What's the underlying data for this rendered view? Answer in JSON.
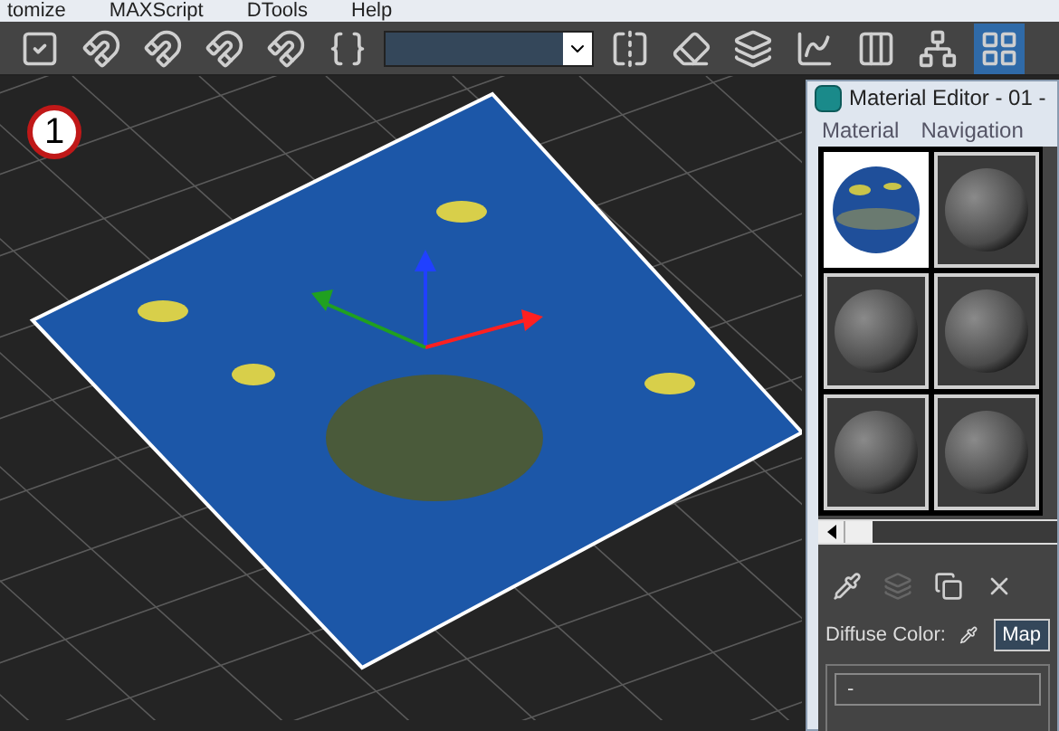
{
  "menu_bar": [
    "tomize",
    "MAXScript",
    "DTools",
    "Help"
  ],
  "toolbar": {
    "buttons": [
      {
        "kind": "check",
        "selected": false
      },
      {
        "kind": "snap3",
        "selected": false
      },
      {
        "kind": "angle",
        "selected": false
      },
      {
        "kind": "percent",
        "selected": false
      },
      {
        "kind": "spinner",
        "selected": false
      },
      {
        "kind": "braces",
        "selected": false
      },
      {
        "kind": "dropdown",
        "selected": false
      },
      {
        "kind": "mirror",
        "selected": false
      },
      {
        "kind": "align",
        "selected": false
      },
      {
        "kind": "layers",
        "selected": false
      },
      {
        "kind": "curves",
        "selected": false
      },
      {
        "kind": "dope",
        "selected": false
      },
      {
        "kind": "schematic",
        "selected": false
      },
      {
        "kind": "material",
        "selected": true
      }
    ]
  },
  "viewport": {
    "badge": "1"
  },
  "material_editor": {
    "title": "Material Editor - 01 -",
    "menus": [
      "Material",
      "Navigation"
    ],
    "slots": [
      {
        "kind": "photo",
        "selected": true
      },
      {
        "kind": "sphere",
        "selected": false
      },
      {
        "kind": "sphere",
        "selected": false
      },
      {
        "kind": "sphere",
        "selected": false
      },
      {
        "kind": "sphere",
        "selected": false
      },
      {
        "kind": "sphere",
        "selected": false
      }
    ],
    "tools": [
      {
        "kind": "get",
        "disabled": false
      },
      {
        "kind": "put",
        "disabled": true
      },
      {
        "kind": "assign",
        "disabled": false
      },
      {
        "kind": "delete",
        "disabled": false
      }
    ],
    "diffuse_label": "Diffuse Color:",
    "map_button": "Map",
    "map_field": "-"
  }
}
